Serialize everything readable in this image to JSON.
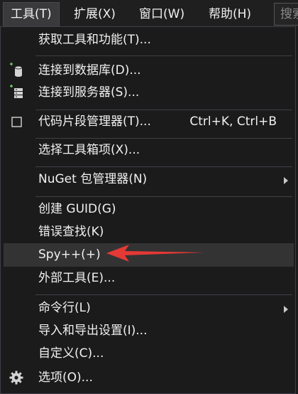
{
  "menubar": {
    "items": [
      {
        "label": "工具(T)",
        "active": true
      },
      {
        "label": "扩展(X)",
        "active": false
      },
      {
        "label": "窗口(W)",
        "active": false
      },
      {
        "label": "帮助(H)",
        "active": false
      }
    ],
    "search_text": "搜索"
  },
  "dropdown": {
    "items": [
      {
        "label": "获取工具和功能(T)...",
        "icon": "",
        "shortcut": "",
        "submenu": false
      },
      {
        "label": "连接到数据库(D)...",
        "icon": "database-connect-icon",
        "shortcut": "",
        "submenu": false
      },
      {
        "label": "连接到服务器(S)...",
        "icon": "server-connect-icon",
        "shortcut": "",
        "submenu": false
      },
      {
        "label": "代码片段管理器(T)...",
        "icon": "snippet-checkbox-icon",
        "shortcut": "Ctrl+K, Ctrl+B",
        "submenu": false
      },
      {
        "label": "选择工具箱项(X)...",
        "icon": "",
        "shortcut": "",
        "submenu": false
      },
      {
        "label": "NuGet 包管理器(N)",
        "icon": "",
        "shortcut": "",
        "submenu": true
      },
      {
        "label": "创建 GUID(G)",
        "icon": "",
        "shortcut": "",
        "submenu": false
      },
      {
        "label": "错误查找(K)",
        "icon": "",
        "shortcut": "",
        "submenu": false
      },
      {
        "label": "Spy++(+)",
        "icon": "",
        "shortcut": "",
        "submenu": false,
        "highlighted": true
      },
      {
        "label": "外部工具(E)...",
        "icon": "",
        "shortcut": "",
        "submenu": false
      },
      {
        "label": "命令行(L)",
        "icon": "",
        "shortcut": "",
        "submenu": true
      },
      {
        "label": "导入和导出设置(I)...",
        "icon": "",
        "shortcut": "",
        "submenu": false
      },
      {
        "label": "自定义(C)...",
        "icon": "",
        "shortcut": "",
        "submenu": false
      },
      {
        "label": "选项(O)...",
        "icon": "gear-icon",
        "shortcut": "",
        "submenu": false
      }
    ]
  },
  "colors": {
    "background": "#1b1b1c",
    "highlight": "#333334",
    "accent_arrow": "#e53935",
    "icon_green": "#6ccb5f"
  }
}
